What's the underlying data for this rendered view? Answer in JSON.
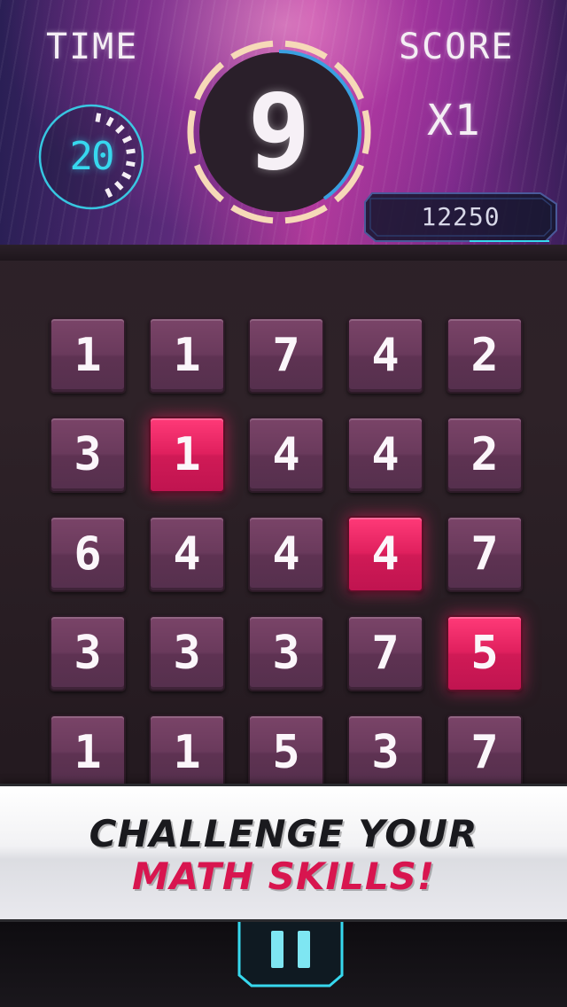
{
  "hud": {
    "time_label": "TIME",
    "time_value": "20",
    "score_label": "SCORE",
    "multiplier": "X1",
    "target": "9",
    "score": "12250"
  },
  "grid": {
    "rows": [
      [
        "1",
        "1",
        "7",
        "4",
        "2"
      ],
      [
        "3",
        "1",
        "4",
        "4",
        "2"
      ],
      [
        "6",
        "4",
        "4",
        "4",
        "7"
      ],
      [
        "3",
        "3",
        "3",
        "7",
        "5"
      ],
      [
        "1",
        "1",
        "5",
        "3",
        "7"
      ]
    ],
    "selected": [
      [
        1,
        1
      ],
      [
        2,
        3
      ],
      [
        3,
        4
      ]
    ]
  },
  "banner": {
    "line1": "CHALLENGE YOUR",
    "line2": "MATH SKILLS!"
  },
  "colors": {
    "accent_cyan": "#37d8ee",
    "selected_tile": "#e0205e",
    "tile": "#6a3a5c",
    "banner_red": "#d8154f"
  },
  "icons": {
    "pause": "pause-icon"
  }
}
